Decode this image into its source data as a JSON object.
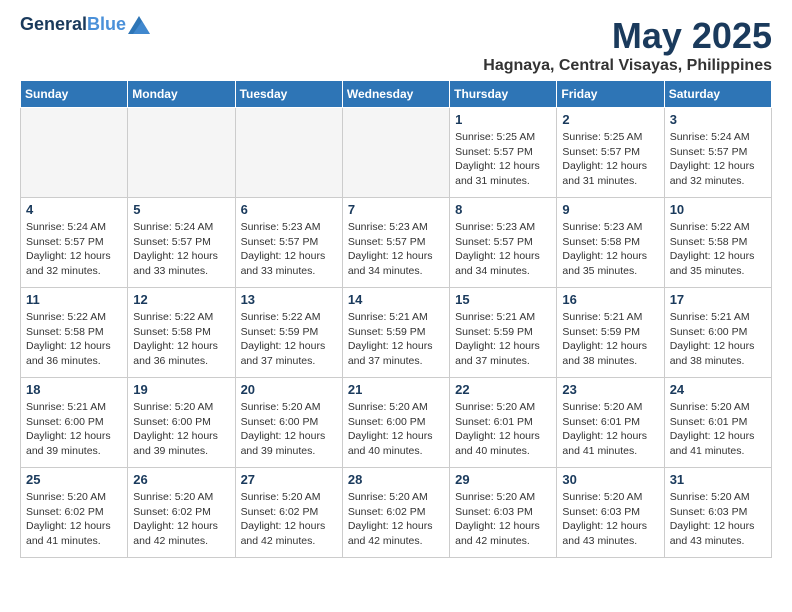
{
  "header": {
    "logo_line1": "General",
    "logo_line2": "Blue",
    "month_year": "May 2025",
    "location": "Hagnaya, Central Visayas, Philippines"
  },
  "weekdays": [
    "Sunday",
    "Monday",
    "Tuesday",
    "Wednesday",
    "Thursday",
    "Friday",
    "Saturday"
  ],
  "weeks": [
    [
      {
        "day": "",
        "info": ""
      },
      {
        "day": "",
        "info": ""
      },
      {
        "day": "",
        "info": ""
      },
      {
        "day": "",
        "info": ""
      },
      {
        "day": "1",
        "info": "Sunrise: 5:25 AM\nSunset: 5:57 PM\nDaylight: 12 hours\nand 31 minutes."
      },
      {
        "day": "2",
        "info": "Sunrise: 5:25 AM\nSunset: 5:57 PM\nDaylight: 12 hours\nand 31 minutes."
      },
      {
        "day": "3",
        "info": "Sunrise: 5:24 AM\nSunset: 5:57 PM\nDaylight: 12 hours\nand 32 minutes."
      }
    ],
    [
      {
        "day": "4",
        "info": "Sunrise: 5:24 AM\nSunset: 5:57 PM\nDaylight: 12 hours\nand 32 minutes."
      },
      {
        "day": "5",
        "info": "Sunrise: 5:24 AM\nSunset: 5:57 PM\nDaylight: 12 hours\nand 33 minutes."
      },
      {
        "day": "6",
        "info": "Sunrise: 5:23 AM\nSunset: 5:57 PM\nDaylight: 12 hours\nand 33 minutes."
      },
      {
        "day": "7",
        "info": "Sunrise: 5:23 AM\nSunset: 5:57 PM\nDaylight: 12 hours\nand 34 minutes."
      },
      {
        "day": "8",
        "info": "Sunrise: 5:23 AM\nSunset: 5:57 PM\nDaylight: 12 hours\nand 34 minutes."
      },
      {
        "day": "9",
        "info": "Sunrise: 5:23 AM\nSunset: 5:58 PM\nDaylight: 12 hours\nand 35 minutes."
      },
      {
        "day": "10",
        "info": "Sunrise: 5:22 AM\nSunset: 5:58 PM\nDaylight: 12 hours\nand 35 minutes."
      }
    ],
    [
      {
        "day": "11",
        "info": "Sunrise: 5:22 AM\nSunset: 5:58 PM\nDaylight: 12 hours\nand 36 minutes."
      },
      {
        "day": "12",
        "info": "Sunrise: 5:22 AM\nSunset: 5:58 PM\nDaylight: 12 hours\nand 36 minutes."
      },
      {
        "day": "13",
        "info": "Sunrise: 5:22 AM\nSunset: 5:59 PM\nDaylight: 12 hours\nand 37 minutes."
      },
      {
        "day": "14",
        "info": "Sunrise: 5:21 AM\nSunset: 5:59 PM\nDaylight: 12 hours\nand 37 minutes."
      },
      {
        "day": "15",
        "info": "Sunrise: 5:21 AM\nSunset: 5:59 PM\nDaylight: 12 hours\nand 37 minutes."
      },
      {
        "day": "16",
        "info": "Sunrise: 5:21 AM\nSunset: 5:59 PM\nDaylight: 12 hours\nand 38 minutes."
      },
      {
        "day": "17",
        "info": "Sunrise: 5:21 AM\nSunset: 6:00 PM\nDaylight: 12 hours\nand 38 minutes."
      }
    ],
    [
      {
        "day": "18",
        "info": "Sunrise: 5:21 AM\nSunset: 6:00 PM\nDaylight: 12 hours\nand 39 minutes."
      },
      {
        "day": "19",
        "info": "Sunrise: 5:20 AM\nSunset: 6:00 PM\nDaylight: 12 hours\nand 39 minutes."
      },
      {
        "day": "20",
        "info": "Sunrise: 5:20 AM\nSunset: 6:00 PM\nDaylight: 12 hours\nand 39 minutes."
      },
      {
        "day": "21",
        "info": "Sunrise: 5:20 AM\nSunset: 6:00 PM\nDaylight: 12 hours\nand 40 minutes."
      },
      {
        "day": "22",
        "info": "Sunrise: 5:20 AM\nSunset: 6:01 PM\nDaylight: 12 hours\nand 40 minutes."
      },
      {
        "day": "23",
        "info": "Sunrise: 5:20 AM\nSunset: 6:01 PM\nDaylight: 12 hours\nand 41 minutes."
      },
      {
        "day": "24",
        "info": "Sunrise: 5:20 AM\nSunset: 6:01 PM\nDaylight: 12 hours\nand 41 minutes."
      }
    ],
    [
      {
        "day": "25",
        "info": "Sunrise: 5:20 AM\nSunset: 6:02 PM\nDaylight: 12 hours\nand 41 minutes."
      },
      {
        "day": "26",
        "info": "Sunrise: 5:20 AM\nSunset: 6:02 PM\nDaylight: 12 hours\nand 42 minutes."
      },
      {
        "day": "27",
        "info": "Sunrise: 5:20 AM\nSunset: 6:02 PM\nDaylight: 12 hours\nand 42 minutes."
      },
      {
        "day": "28",
        "info": "Sunrise: 5:20 AM\nSunset: 6:02 PM\nDaylight: 12 hours\nand 42 minutes."
      },
      {
        "day": "29",
        "info": "Sunrise: 5:20 AM\nSunset: 6:03 PM\nDaylight: 12 hours\nand 42 minutes."
      },
      {
        "day": "30",
        "info": "Sunrise: 5:20 AM\nSunset: 6:03 PM\nDaylight: 12 hours\nand 43 minutes."
      },
      {
        "day": "31",
        "info": "Sunrise: 5:20 AM\nSunset: 6:03 PM\nDaylight: 12 hours\nand 43 minutes."
      }
    ]
  ]
}
